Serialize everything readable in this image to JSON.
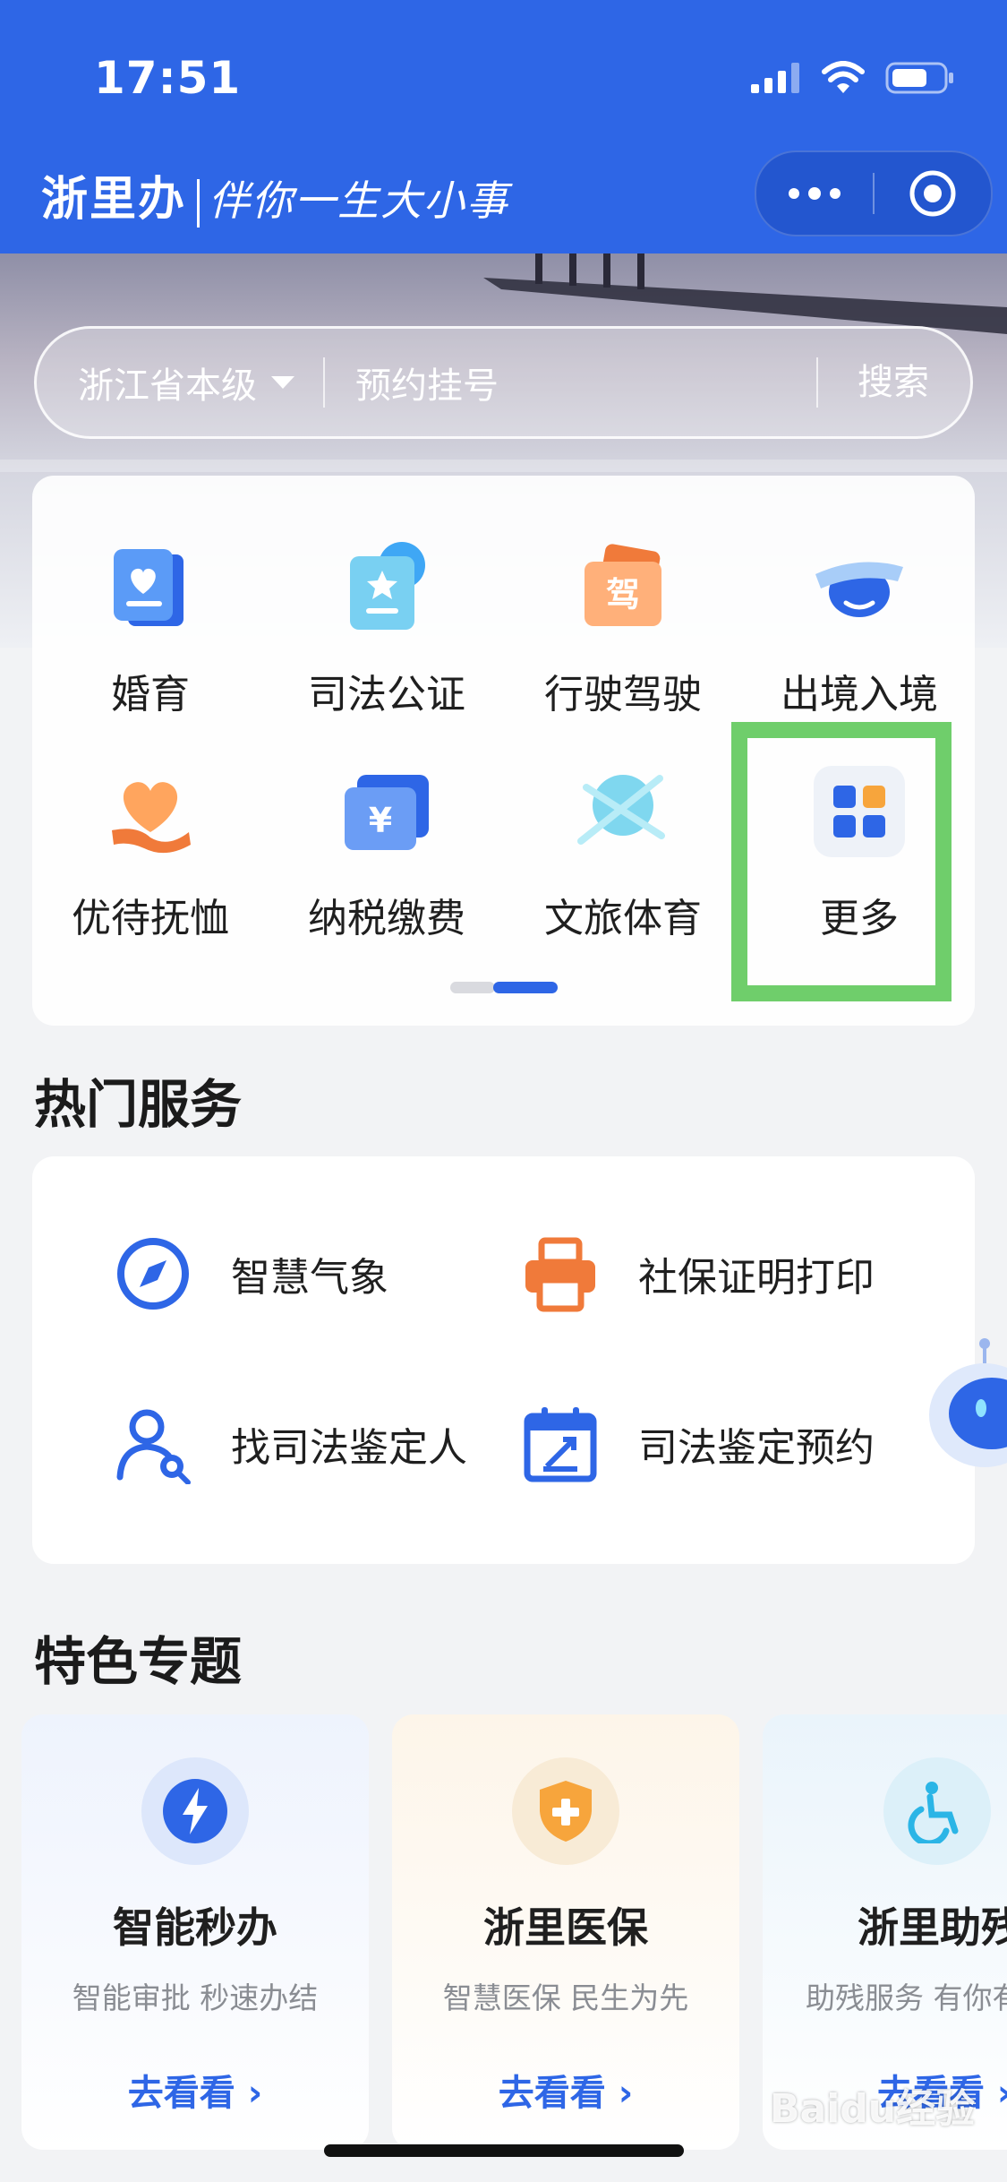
{
  "status_bar": {
    "time": "17:51"
  },
  "header": {
    "brand": "浙里办",
    "slogan": "伴你一生大小事"
  },
  "search": {
    "region": "浙江省本级",
    "keyword": "预约挂号",
    "button": "搜索"
  },
  "categories": [
    {
      "label": "婚育",
      "icon": "marriage-icon"
    },
    {
      "label": "司法公证",
      "icon": "notary-icon"
    },
    {
      "label": "行驶驾驶",
      "icon": "driving-icon"
    },
    {
      "label": "出境入境",
      "icon": "airplane-icon"
    },
    {
      "label": "优待抚恤",
      "icon": "heart-hand-icon"
    },
    {
      "label": "纳税缴费",
      "icon": "tax-icon"
    },
    {
      "label": "文旅体育",
      "icon": "tourism-icon"
    },
    {
      "label": "更多",
      "icon": "more-grid-icon"
    }
  ],
  "hot": {
    "title": "热门服务",
    "items": [
      {
        "label": "智慧气象",
        "icon": "compass-icon"
      },
      {
        "label": "社保证明打印",
        "icon": "printer-icon"
      },
      {
        "label": "找司法鉴定人",
        "icon": "person-search-icon"
      },
      {
        "label": "司法鉴定预约",
        "icon": "calendar-icon"
      }
    ]
  },
  "topics": {
    "title": "特色专题",
    "items": [
      {
        "title": "智能秒办",
        "subtitle": "智能审批 秒速办结",
        "link": "去看看 ›",
        "icon": "lightning-icon"
      },
      {
        "title": "浙里医保",
        "subtitle": "智慧医保 民生为先",
        "link": "去看看 ›",
        "icon": "medical-shield-icon"
      },
      {
        "title": "浙里助残",
        "subtitle": "助残服务 有你有我",
        "link": "去看看 ›",
        "icon": "wheelchair-icon"
      }
    ]
  },
  "watermark": "Baidu经验",
  "colors": {
    "primary": "#2e66e6",
    "highlight": "#6fce6b"
  }
}
